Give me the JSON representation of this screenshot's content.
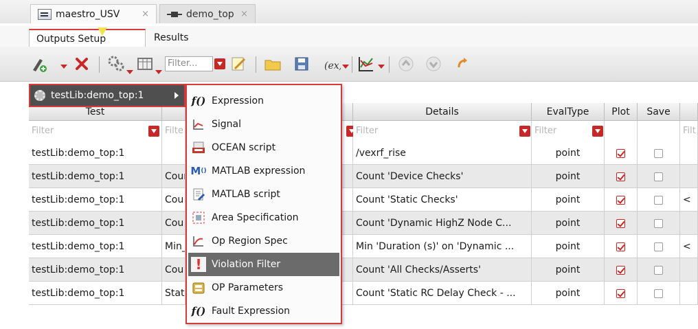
{
  "tabs": {
    "doc_tabs": [
      {
        "label": "maestro_USV",
        "close": "×",
        "icon": "document-icon"
      },
      {
        "label": "demo_top",
        "close": "×",
        "icon": "chip-icon"
      }
    ],
    "view_tabs": [
      "Outputs Setup",
      "Results"
    ]
  },
  "toolbar": {
    "filter_placeholder": "Filter..."
  },
  "submenu_trigger": {
    "label": "testLib:demo_top:1",
    "icon": "gear-icon"
  },
  "table": {
    "headers": [
      "Test",
      "",
      "",
      "Details",
      "EvalType",
      "Plot",
      "Save",
      ""
    ],
    "filter_placeholder": "Filter",
    "filters": [
      "Filter",
      "Filte",
      "",
      "Filter",
      "Filter",
      "",
      "",
      "Filt"
    ],
    "rows": [
      {
        "test": "testLib:demo_top:1",
        "name": "",
        "details": "/vexrf_rise",
        "evaltype": "point",
        "plot": true,
        "save": false,
        "extra": ""
      },
      {
        "test": "testLib:demo_top:1",
        "name": "Count",
        "details": "Count 'Device Checks'",
        "evaltype": "point",
        "plot": true,
        "save": false,
        "extra": ""
      },
      {
        "test": "testLib:demo_top:1",
        "name": "Cou",
        "details": "Count 'Static Checks'",
        "evaltype": "point",
        "plot": true,
        "save": false,
        "extra": "<"
      },
      {
        "test": "testLib:demo_top:1",
        "name": "Cou",
        "details": "Count 'Dynamic HighZ Node C...",
        "evaltype": "point",
        "plot": true,
        "save": false,
        "extra": ""
      },
      {
        "test": "testLib:demo_top:1",
        "name": "Min_",
        "details": "Min 'Duration (s)' on 'Dynamic ...",
        "evaltype": "point",
        "plot": true,
        "save": false,
        "extra": "<"
      },
      {
        "test": "testLib:demo_top:1",
        "name": "Cou",
        "details": "Count 'All Checks/Asserts'",
        "evaltype": "point",
        "plot": true,
        "save": false,
        "extra": ""
      },
      {
        "test": "testLib:demo_top:1",
        "name": "Stati",
        "details": "Count 'Static RC Delay Check - ...",
        "evaltype": "point",
        "plot": true,
        "save": false,
        "extra": ""
      }
    ]
  },
  "menu": {
    "items": [
      {
        "label": "Expression",
        "icon": "f0"
      },
      {
        "label": "Signal",
        "icon": "signal-icon"
      },
      {
        "label": "OCEAN script",
        "icon": "ocean-script-icon"
      },
      {
        "label": "MATLAB expression",
        "icon": "matlab-expression-icon"
      },
      {
        "label": "MATLAB script",
        "icon": "matlab-script-icon"
      },
      {
        "label": "Area Specification",
        "icon": "area-spec-icon"
      },
      {
        "label": "Op Region Spec",
        "icon": "op-region-icon"
      },
      {
        "label": "Violation Filter",
        "icon": "violation-icon",
        "highlighted": true
      },
      {
        "label": "OP Parameters",
        "icon": "op-parameters-icon"
      },
      {
        "label": "Fault Expression",
        "icon": "f0"
      }
    ]
  },
  "colors": {
    "accent": "#d63b3b",
    "highlight": "#6b6b6b",
    "check": "#c62828"
  }
}
